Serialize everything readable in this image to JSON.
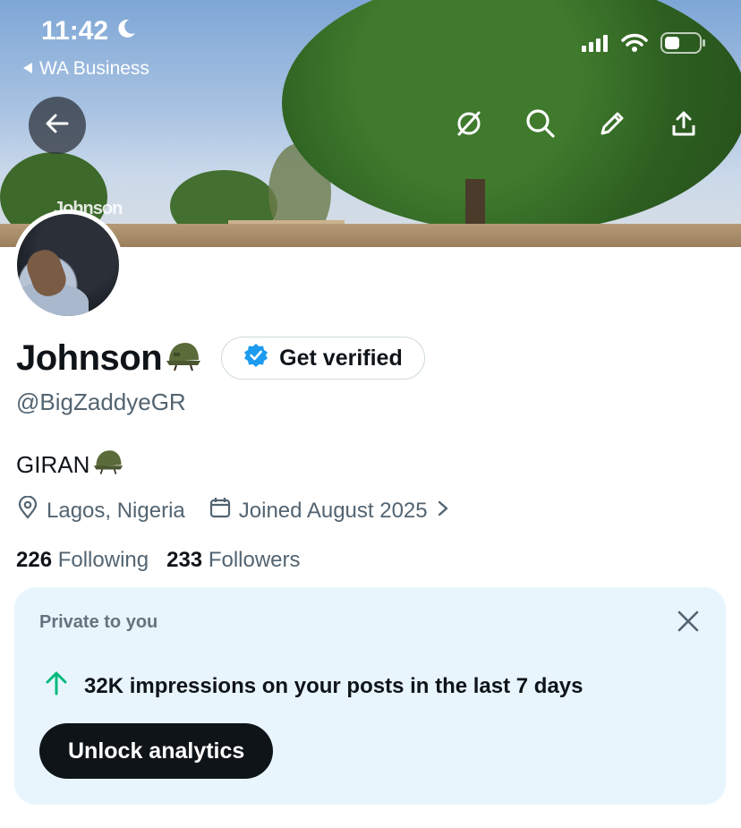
{
  "status_bar": {
    "time": "11:42",
    "back_app": "WA Business"
  },
  "banner": {
    "watermark": "Johnson"
  },
  "profile": {
    "name": "Johnson",
    "name_emoji": "🪖",
    "get_verified_label": "Get verified",
    "handle": "@BigZaddyeGR",
    "bio_text": "GIRAN",
    "bio_emoji": "🪖",
    "location": "Lagos, Nigeria",
    "joined": "Joined August 2025",
    "following_count": "226",
    "following_label": "Following",
    "followers_count": "233",
    "followers_label": "Followers"
  },
  "analytics_card": {
    "title": "Private to you",
    "message": "32K impressions on your posts in the last 7 days",
    "button_label": "Unlock analytics"
  },
  "icons": {
    "back": "arrow-left-icon",
    "grok": "grok-icon",
    "search": "search-icon",
    "edit": "pencil-icon",
    "share": "share-icon",
    "location": "location-pin-icon",
    "calendar": "calendar-icon",
    "trend": "arrow-up-icon",
    "close": "close-icon"
  },
  "colors": {
    "text_primary": "#0f1419",
    "text_secondary": "#536471",
    "verified_blue": "#1d9bf0",
    "card_bg": "#e8f5fd",
    "trend_green": "#00ba7c"
  }
}
